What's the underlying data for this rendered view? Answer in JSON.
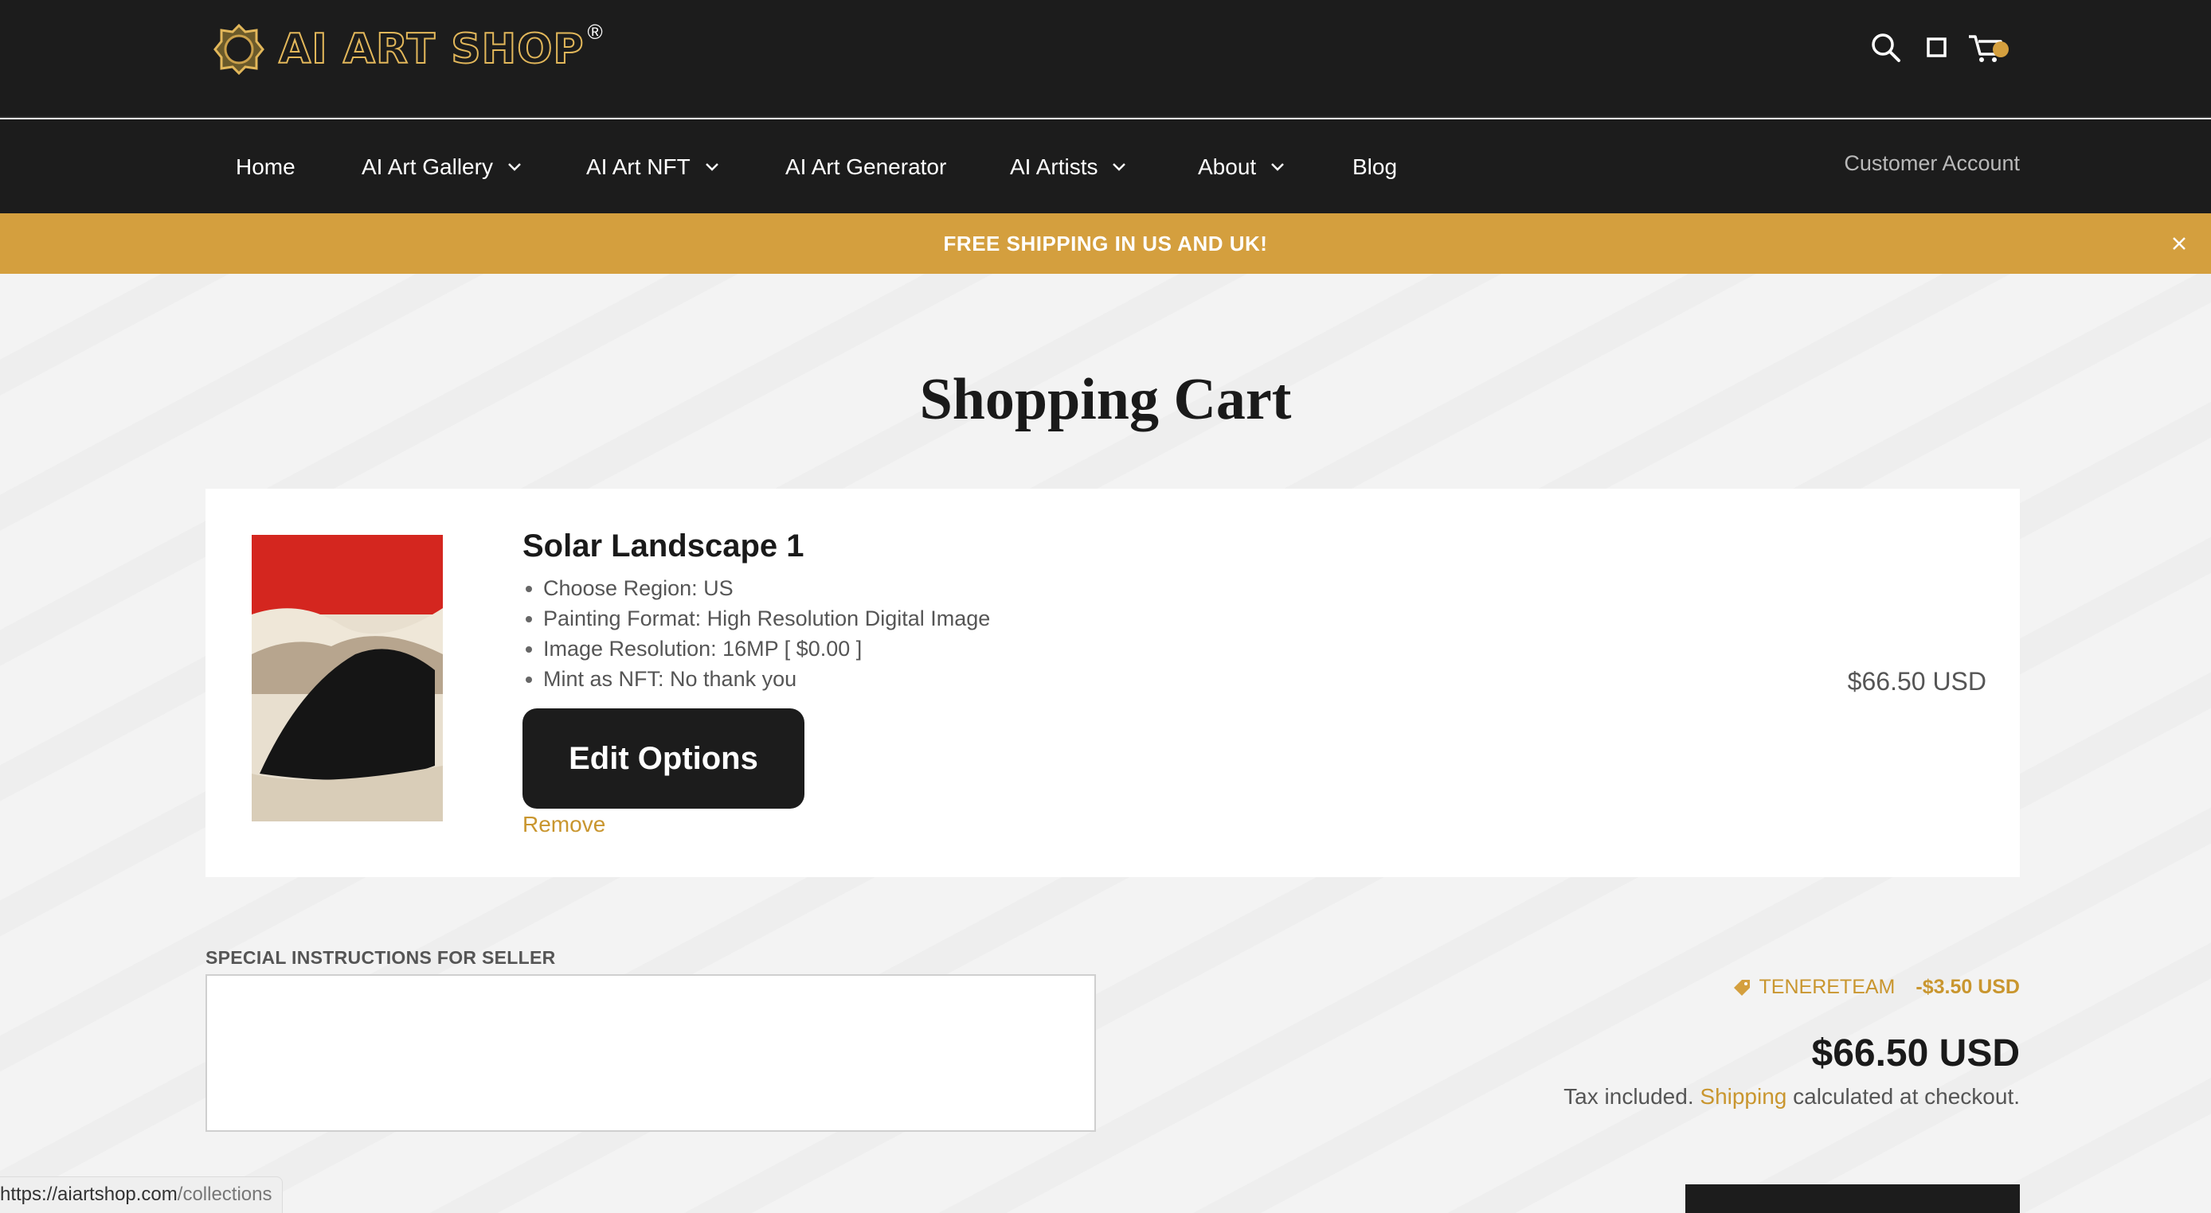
{
  "header": {
    "logo_text": "AI ART SHOP",
    "logo_reg": "®",
    "icons": [
      "search-icon",
      "square-icon",
      "cart-icon"
    ],
    "accent": "#d49f3e"
  },
  "nav": {
    "items": [
      {
        "label": "Home",
        "dropdown": false
      },
      {
        "label": "AI Art Gallery",
        "dropdown": true
      },
      {
        "label": "AI Art NFT",
        "dropdown": true
      },
      {
        "label": "AI Art Generator",
        "dropdown": false
      },
      {
        "label": "AI Artists",
        "dropdown": true
      },
      {
        "label": "About",
        "dropdown": true
      },
      {
        "label": "Blog",
        "dropdown": false
      }
    ],
    "account": "Customer Account"
  },
  "promo": {
    "text": "FREE SHIPPING IN US AND UK!"
  },
  "page": {
    "title": "Shopping Cart"
  },
  "cart": {
    "item": {
      "name": "Solar Landscape 1",
      "options": [
        "Choose Region: US",
        "Painting Format: High Resolution Digital Image",
        "Image Resolution: 16MP [ $0.00 ]",
        "Mint as NFT: No thank you"
      ],
      "edit_label": "Edit Options",
      "remove_label": "Remove",
      "price": "$66.50 USD"
    }
  },
  "notes": {
    "label": "SPECIAL INSTRUCTIONS FOR SELLER",
    "value": ""
  },
  "summary": {
    "discount_code": "TENERETEAM",
    "discount_amount": "-$3.50 USD",
    "total": "$66.50 USD",
    "tax_prefix": "Tax included.",
    "shipping_link": "Shipping",
    "tax_suffix": "calculated at checkout."
  },
  "statusbar": {
    "host": "https://aiartshop.com",
    "path": "/collections"
  }
}
